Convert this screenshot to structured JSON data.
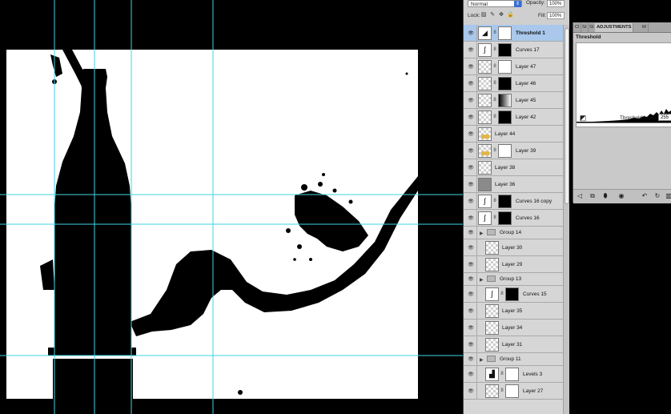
{
  "layers_panel": {
    "blend_mode": "Normal",
    "opacity_label": "Opacity:",
    "opacity_value": "100%",
    "lock_label": "Lock:",
    "fill_label": "Fill:",
    "fill_value": "100%",
    "lock_icons": [
      "lock-transparent-pixels-icon",
      "lock-image-pixels-icon",
      "lock-position-icon",
      "lock-all-icon"
    ],
    "layers": [
      {
        "name": "Threshold 1",
        "type": "adjustment",
        "selected": true,
        "thumb": "white",
        "icon": "threshold-icon"
      },
      {
        "name": "Curves 17",
        "type": "adjustment",
        "thumb": "black",
        "icon": "curves-icon"
      },
      {
        "name": "Layer 47",
        "type": "layer",
        "thumb": "white"
      },
      {
        "name": "Layer 46",
        "type": "layer",
        "thumb": "black"
      },
      {
        "name": "Layer 45",
        "type": "layer",
        "thumb": "grad"
      },
      {
        "name": "Layer 42",
        "type": "layer",
        "thumb": "black"
      },
      {
        "name": "Layer 44",
        "type": "pixel",
        "thumb": "gold"
      },
      {
        "name": "Layer 39",
        "type": "layer-gold",
        "thumb": "white"
      },
      {
        "name": "Layer 38",
        "type": "pixel",
        "thumb": "checker"
      },
      {
        "name": "Layer 36",
        "type": "pixel",
        "thumb": "grey"
      },
      {
        "name": "Curves 16 copy",
        "type": "adjustment",
        "thumb": "black",
        "icon": "curves-icon"
      },
      {
        "name": "Curves 16",
        "type": "adjustment",
        "thumb": "black",
        "icon": "curves-icon"
      },
      {
        "name": "Group 14",
        "type": "group"
      },
      {
        "name": "Layer 30",
        "type": "pixel",
        "thumb": "checker",
        "indent": true
      },
      {
        "name": "Layer 29",
        "type": "pixel",
        "thumb": "checker",
        "indent": true
      },
      {
        "name": "Group 13",
        "type": "group"
      },
      {
        "name": "Curves 15",
        "type": "adjustment",
        "thumb": "black",
        "icon": "curves-icon",
        "indent": true
      },
      {
        "name": "Layer 35",
        "type": "pixel",
        "thumb": "checker",
        "indent": true
      },
      {
        "name": "Layer 34",
        "type": "pixel",
        "thumb": "checker",
        "indent": true
      },
      {
        "name": "Layer 31",
        "type": "pixel",
        "thumb": "checker",
        "indent": true
      },
      {
        "name": "Group 11",
        "type": "group"
      },
      {
        "name": "Levels 3",
        "type": "adjustment",
        "thumb": "white",
        "icon": "levels-icon",
        "indent": true
      },
      {
        "name": "Layer 27",
        "type": "layer",
        "thumb": "white",
        "indent": true
      }
    ]
  },
  "adjustments_panel": {
    "tabs": [
      "Cl",
      "St",
      "St",
      "ADJUSTMENTS",
      "M"
    ],
    "active_tab": "ADJUSTMENTS",
    "title": "Threshold",
    "threshold_label": "Threshold Level:",
    "threshold_value": "255",
    "bottom_icons": [
      "back-icon",
      "expand-icon",
      "clip-icon",
      "visibility-icon",
      "reset-previous-icon",
      "reset-icon",
      "trash-icon"
    ]
  },
  "colors": {
    "guide": "#3fd6e6",
    "selected_layer": "#a9c8ec",
    "panel_bg": "#d6d6d6"
  }
}
